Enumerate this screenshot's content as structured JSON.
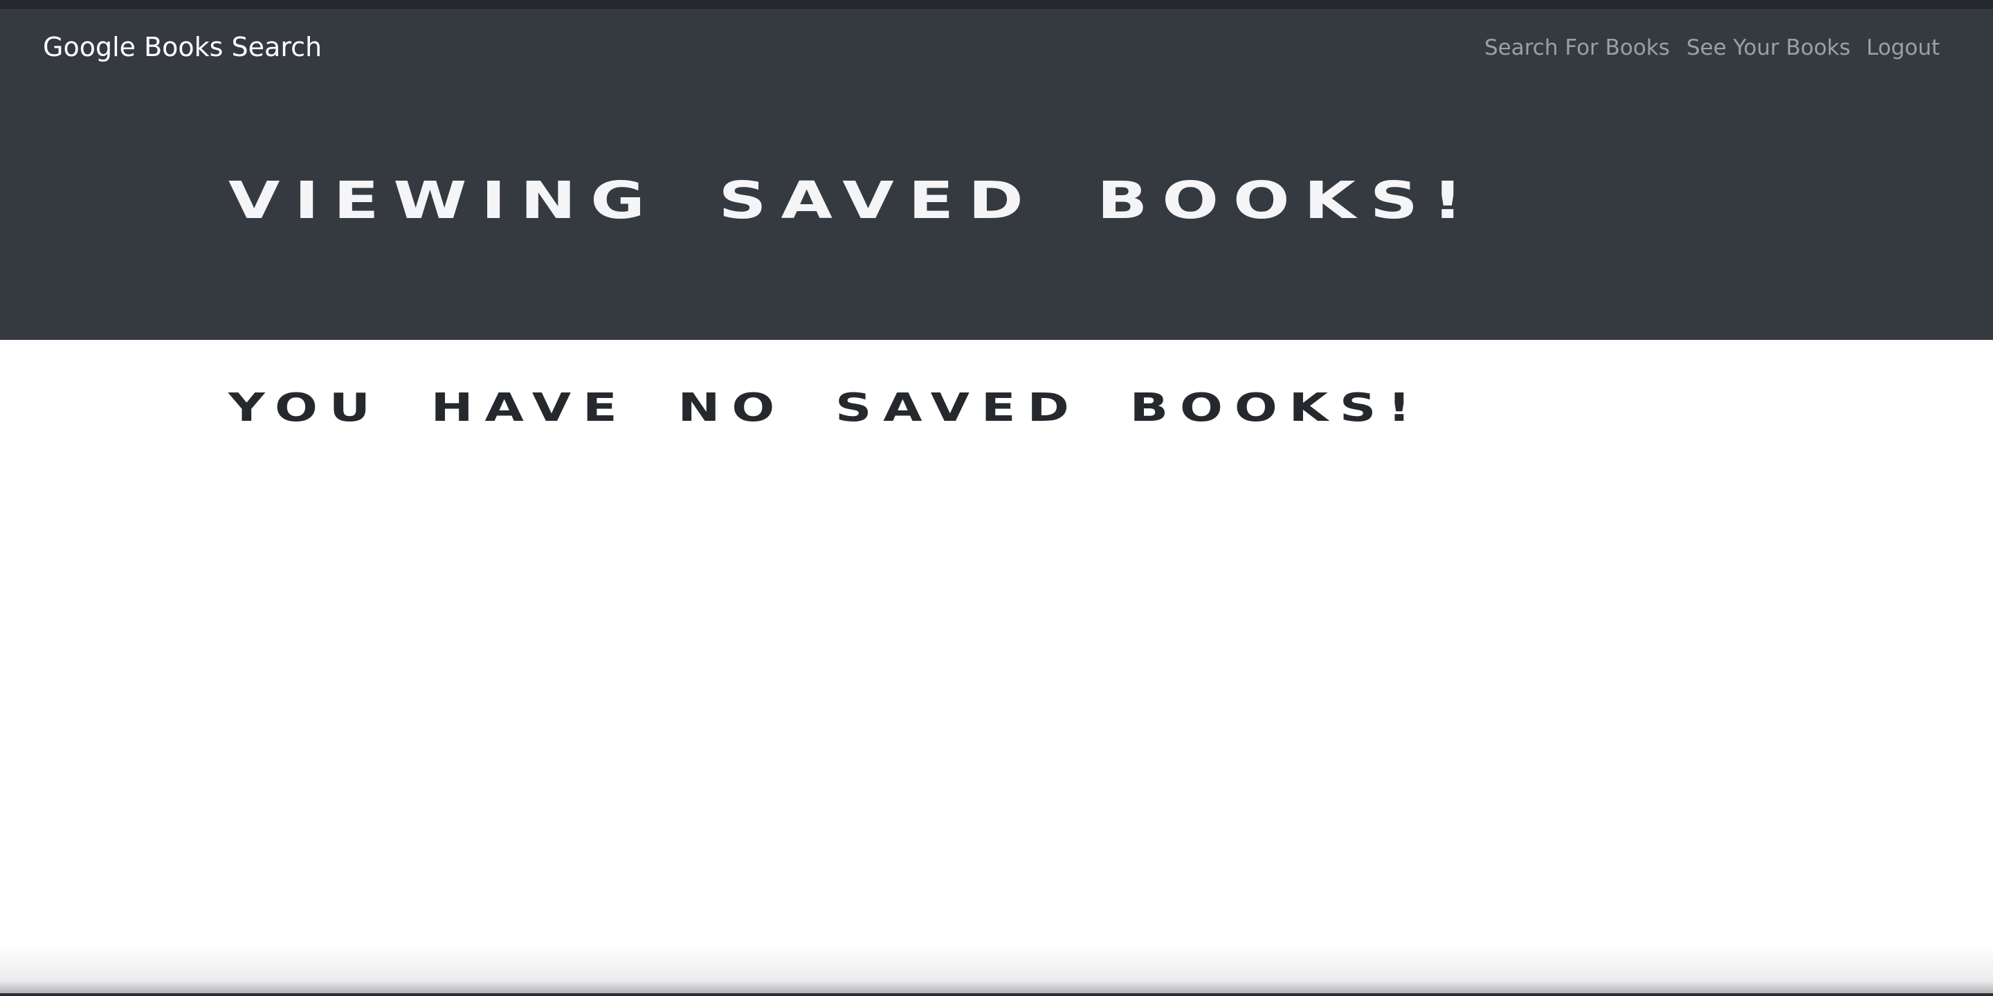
{
  "navbar": {
    "brand": "Google Books Search",
    "links": [
      {
        "label": "Search For Books"
      },
      {
        "label": "See Your Books"
      },
      {
        "label": "Logout"
      }
    ]
  },
  "hero": {
    "title": "Viewing saved books!"
  },
  "main": {
    "empty_message": "You have no saved books!"
  },
  "colors": {
    "navbar_bg": "#353a40",
    "hero_text": "#f5f5f8",
    "body_text": "#25292d",
    "nav_link": "#9aa0a6"
  }
}
